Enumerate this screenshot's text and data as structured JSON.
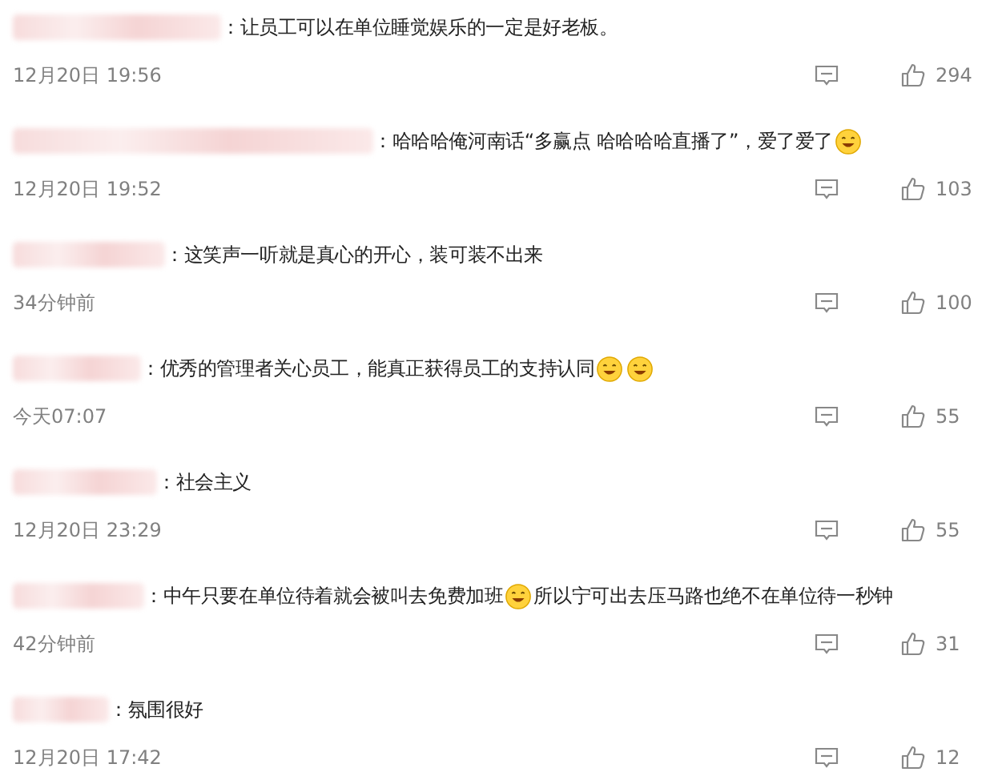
{
  "comments": [
    {
      "parts": [
        {
          "kind": "text",
          "text": "：让员工可以在单位睡觉娱乐的一定是好老板。"
        }
      ],
      "time": "12月20日 19:56",
      "likes": "294"
    },
    {
      "parts": [
        {
          "kind": "text",
          "text": "：哈哈哈俺河南话“多赢点 哈哈哈哈直播了”，爱了爱了"
        },
        {
          "kind": "emoji"
        }
      ],
      "time": "12月20日 19:52",
      "likes": "103"
    },
    {
      "parts": [
        {
          "kind": "text",
          "text": "：这笑声一听就是真心的开心，装可装不出来"
        }
      ],
      "time": "34分钟前",
      "likes": "100"
    },
    {
      "parts": [
        {
          "kind": "text",
          "text": "：优秀的管理者关心员工，能真正获得员工的支持认同"
        },
        {
          "kind": "emoji"
        },
        {
          "kind": "emoji"
        }
      ],
      "time": "今天07:07",
      "likes": "55"
    },
    {
      "parts": [
        {
          "kind": "text",
          "text": "：社会主义"
        }
      ],
      "time": "12月20日 23:29",
      "likes": "55"
    },
    {
      "parts": [
        {
          "kind": "text",
          "text": "：中午只要在单位待着就会被叫去免费加班"
        },
        {
          "kind": "emoji"
        },
        {
          "kind": "text",
          "text": "所以宁可出去压马路也绝不在单位待一秒钟"
        }
      ],
      "time": "42分钟前",
      "likes": "31"
    },
    {
      "parts": [
        {
          "kind": "text",
          "text": "：氛围很好"
        }
      ],
      "time": "12月20日 17:42",
      "likes": "12"
    }
  ]
}
